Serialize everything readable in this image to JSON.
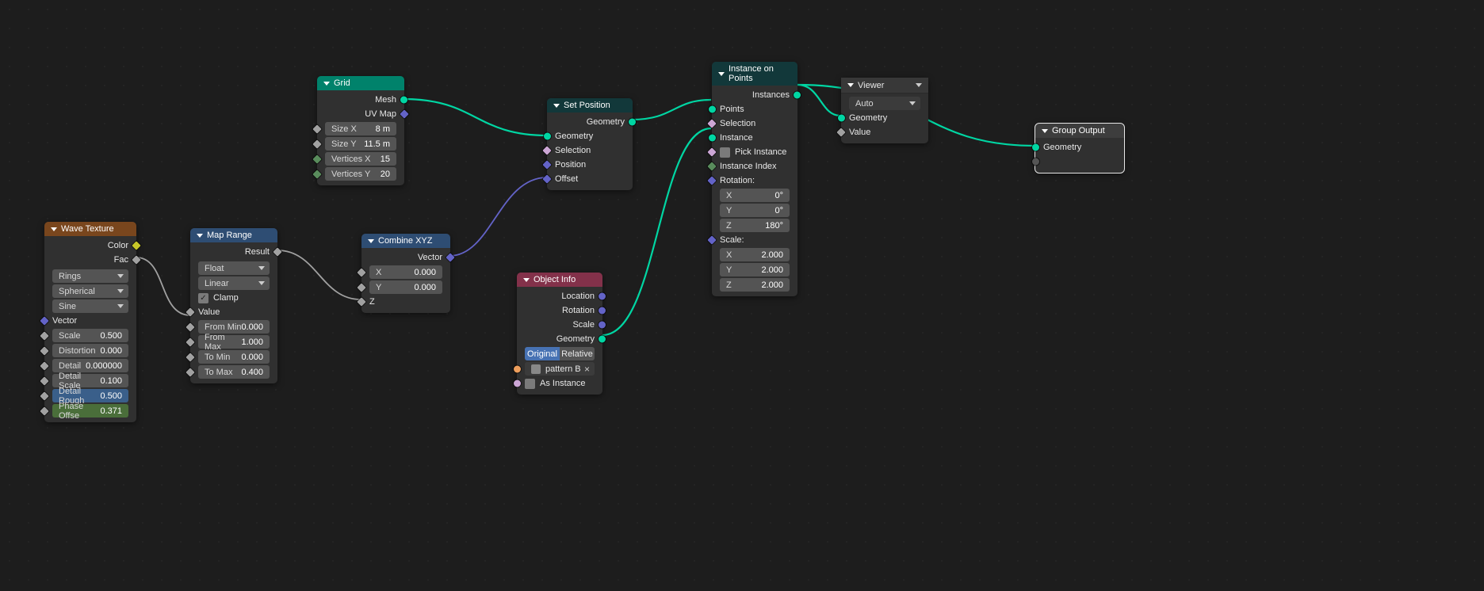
{
  "nodes": {
    "wave": {
      "title": "Wave Texture",
      "outputs": {
        "color": "Color",
        "fac": "Fac"
      },
      "selects": {
        "type": "Rings",
        "direction": "Spherical",
        "profile": "Sine"
      },
      "inputs": {
        "vector": "Vector",
        "scale": {
          "label": "Scale",
          "value": "0.500"
        },
        "distortion": {
          "label": "Distortion",
          "value": "0.000"
        },
        "detail": {
          "label": "Detail",
          "value": "0.000000"
        },
        "detail_scale": {
          "label": "Detail Scale",
          "value": "0.100"
        },
        "detail_rough": {
          "label": "Detail Rough",
          "value": "0.500"
        },
        "phase_offset": {
          "label": "Phase Offse",
          "value": "0.371"
        }
      }
    },
    "maprange": {
      "title": "Map Range",
      "outputs": {
        "result": "Result"
      },
      "selects": {
        "dtype": "Float",
        "interp": "Linear"
      },
      "clamp_label": "Clamp",
      "inputs": {
        "value": "Value",
        "from_min": {
          "label": "From Min",
          "value": "0.000"
        },
        "from_max": {
          "label": "From Max",
          "value": "1.000"
        },
        "to_min": {
          "label": "To Min",
          "value": "0.000"
        },
        "to_max": {
          "label": "To Max",
          "value": "0.400"
        }
      }
    },
    "grid": {
      "title": "Grid",
      "outputs": {
        "mesh": "Mesh",
        "uvmap": "UV Map"
      },
      "inputs": {
        "size_x": {
          "label": "Size X",
          "value": "8 m"
        },
        "size_y": {
          "label": "Size Y",
          "value": "11.5 m"
        },
        "verts_x": {
          "label": "Vertices X",
          "value": "15"
        },
        "verts_y": {
          "label": "Vertices Y",
          "value": "20"
        }
      }
    },
    "combine": {
      "title": "Combine XYZ",
      "outputs": {
        "vector": "Vector"
      },
      "inputs": {
        "x": {
          "label": "X",
          "value": "0.000"
        },
        "y": {
          "label": "Y",
          "value": "0.000"
        },
        "z": "Z"
      }
    },
    "setpos": {
      "title": "Set Position",
      "outputs": {
        "geometry": "Geometry"
      },
      "inputs": {
        "geometry": "Geometry",
        "selection": "Selection",
        "position": "Position",
        "offset": "Offset"
      }
    },
    "objinfo": {
      "title": "Object Info",
      "outputs": {
        "location": "Location",
        "rotation": "Rotation",
        "scale": "Scale",
        "geometry": "Geometry"
      },
      "toggle": {
        "original": "Original",
        "relative": "Relative"
      },
      "object_field": "pattern B",
      "as_instance": "As Instance"
    },
    "iop": {
      "title": "Instance on Points",
      "outputs": {
        "instances": "Instances"
      },
      "inputs": {
        "points": "Points",
        "selection": "Selection",
        "instance": "Instance",
        "pick_instance": "Pick Instance",
        "instance_index": "Instance Index",
        "rotation_label": "Rotation:",
        "rx": {
          "label": "X",
          "value": "0°"
        },
        "ry": {
          "label": "Y",
          "value": "0°"
        },
        "rz": {
          "label": "Z",
          "value": "180°"
        },
        "scale_label": "Scale:",
        "sx": {
          "label": "X",
          "value": "2.000"
        },
        "sy": {
          "label": "Y",
          "value": "2.000"
        },
        "sz": {
          "label": "Z",
          "value": "2.000"
        }
      }
    },
    "viewer": {
      "title": "Viewer",
      "mode": "Auto",
      "inputs": {
        "geometry": "Geometry",
        "value": "Value"
      }
    },
    "groupout": {
      "title": "Group Output",
      "inputs": {
        "geometry": "Geometry"
      }
    }
  }
}
